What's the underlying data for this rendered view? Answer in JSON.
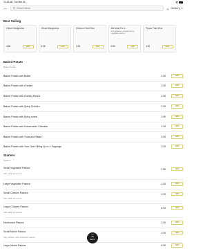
{
  "status": {
    "time": "11:44 AM",
    "date": "Tue Mar 26",
    "wifi_icon": "wifi-icon",
    "battery_icon": "battery-icon"
  },
  "header": {
    "search_placeholder": "Search items",
    "delivery_label": "Delivery"
  },
  "best_selling": {
    "title": "Best Selling",
    "cards": [
      {
        "name": "10inch Margherita",
        "desc": "",
        "price": "4.50",
        "button": "ADD"
      },
      {
        "name": "10inch Margherita",
        "desc": "",
        "price": "5.95",
        "button": "ADD"
      },
      {
        "name": "Chicken Fried Rice",
        "desc": "",
        "price": "3.90",
        "button": "ADD"
      },
      {
        "name": "Set Meal For 1",
        "desc": "2 Poppadoms, special korma, vegetable pakora...",
        "price": "6.90",
        "button": "ADD"
      },
      {
        "name": "Prawn Fried Rice",
        "desc": "",
        "price": "4.90",
        "button": "ADD"
      }
    ]
  },
  "baked_potato": {
    "title": "Baked Potato",
    "subtitle": "Baked Potato",
    "items": [
      {
        "name": "Baked Potato with Butter",
        "price": "2.50",
        "button": "ADD"
      },
      {
        "name": "Baked Potato with Cheese",
        "price": "2.90",
        "button": "ADD"
      },
      {
        "name": "Baked Potato with Cheesy Beans",
        "price": "2.90",
        "button": "ADD"
      },
      {
        "name": "Baked Potato with Spicy Chicken",
        "price": "2.90",
        "button": "ADD"
      },
      {
        "name": "Baked Potato with Spicy Lamb",
        "price": "2.90",
        "button": "ADD"
      },
      {
        "name": "Baked Potato with Homemade Coleslaw",
        "price": "2.90",
        "button": "ADD"
      },
      {
        "name": "Baked Potato with Tuna and Salad",
        "price": "2.90",
        "button": "ADD"
      },
      {
        "name": "Baked Potato with Your Own Filling Up to 4 Toppings",
        "price": "3.90",
        "button": "ADD"
      }
    ]
  },
  "starters": {
    "title": "Starters",
    "subtitle": "Starters",
    "items": [
      {
        "name": "Small Vegetable Pakora",
        "desc": "Side salad and sauce",
        "price": "2.50",
        "button": "ADD"
      },
      {
        "name": "Large Vegetable Pakora",
        "desc": "",
        "price": "4.50",
        "button": "ADD"
      },
      {
        "name": "Small Chicken Pakora",
        "desc": "Side salad and sauce",
        "price": "4.90",
        "button": "ADD"
      },
      {
        "name": "Large Chicken Pakora",
        "desc": "Side salad and sauce",
        "price": "5.90",
        "button": "ADD"
      },
      {
        "name": "Mushroom Pakora",
        "desc": "",
        "price": "3.50",
        "button": "ADD"
      },
      {
        "name": "Small Mixed Pakora",
        "desc": "Veg, chicken, and mushroom pakora",
        "price": "4.50",
        "button": "ADD"
      },
      {
        "name": "Large Mixed Pakora",
        "desc": "",
        "price": "6.50",
        "button": "ADD"
      }
    ]
  },
  "fab": {
    "label": "MENU",
    "icon": "menu-book-icon"
  }
}
